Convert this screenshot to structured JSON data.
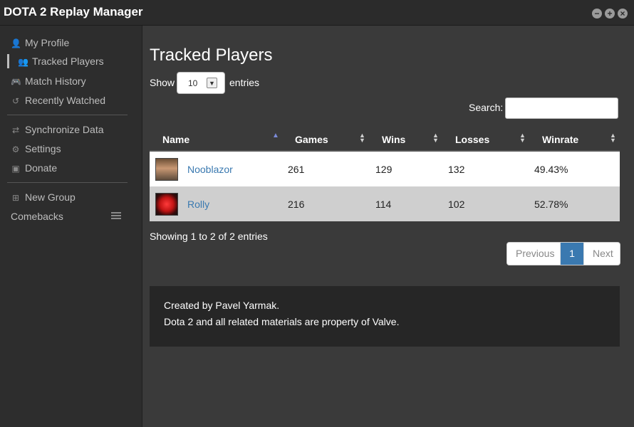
{
  "app": {
    "title": "DOTA 2 Replay Manager"
  },
  "window_controls": {
    "minimize": "−",
    "maximize": "+",
    "close": "×"
  },
  "sidebar": {
    "items": [
      {
        "label": "My Profile",
        "icon": "user-icon",
        "glyph": "👤"
      },
      {
        "label": "Tracked Players",
        "icon": "users-icon",
        "glyph": "👥",
        "active": true
      },
      {
        "label": "Match History",
        "icon": "gamepad-icon",
        "glyph": "🎮"
      },
      {
        "label": "Recently Watched",
        "icon": "history-icon",
        "glyph": "↺"
      },
      {
        "label": "Synchronize Data",
        "icon": "sync-icon",
        "glyph": "⇄"
      },
      {
        "label": "Settings",
        "icon": "gear-icon",
        "glyph": "⚙"
      },
      {
        "label": "Donate",
        "icon": "money-icon",
        "glyph": "▣"
      },
      {
        "label": "New Group",
        "icon": "plus-square-icon",
        "glyph": "⊞"
      },
      {
        "label": "Comebacks",
        "icon": "menu-icon"
      }
    ]
  },
  "main": {
    "title": "Tracked Players",
    "show_label": "Show",
    "page_length": "10",
    "entries_label": "entries",
    "search_label": "Search:",
    "search_value": "",
    "columns": [
      "Name",
      "Games",
      "Wins",
      "Losses",
      "Winrate"
    ],
    "sorted_column": "Name",
    "rows": [
      {
        "name": "Nooblazor",
        "games": "261",
        "wins": "129",
        "losses": "132",
        "winrate": "49.43%"
      },
      {
        "name": "Rolly",
        "games": "216",
        "wins": "114",
        "losses": "102",
        "winrate": "52.78%"
      }
    ],
    "info": "Showing 1 to 2 of 2 entries",
    "pagination": {
      "previous": "Previous",
      "current": "1",
      "next": "Next"
    },
    "footer": {
      "line1": "Created by Pavel Yarmak.",
      "line2": "Dota 2 and all related materials are property of Valve."
    }
  },
  "colors": {
    "accent": "#3a79b0",
    "sort_active": "#7b8ad8",
    "sidebar_bg": "#2d2d2d",
    "main_bg": "#3a3a3a"
  }
}
